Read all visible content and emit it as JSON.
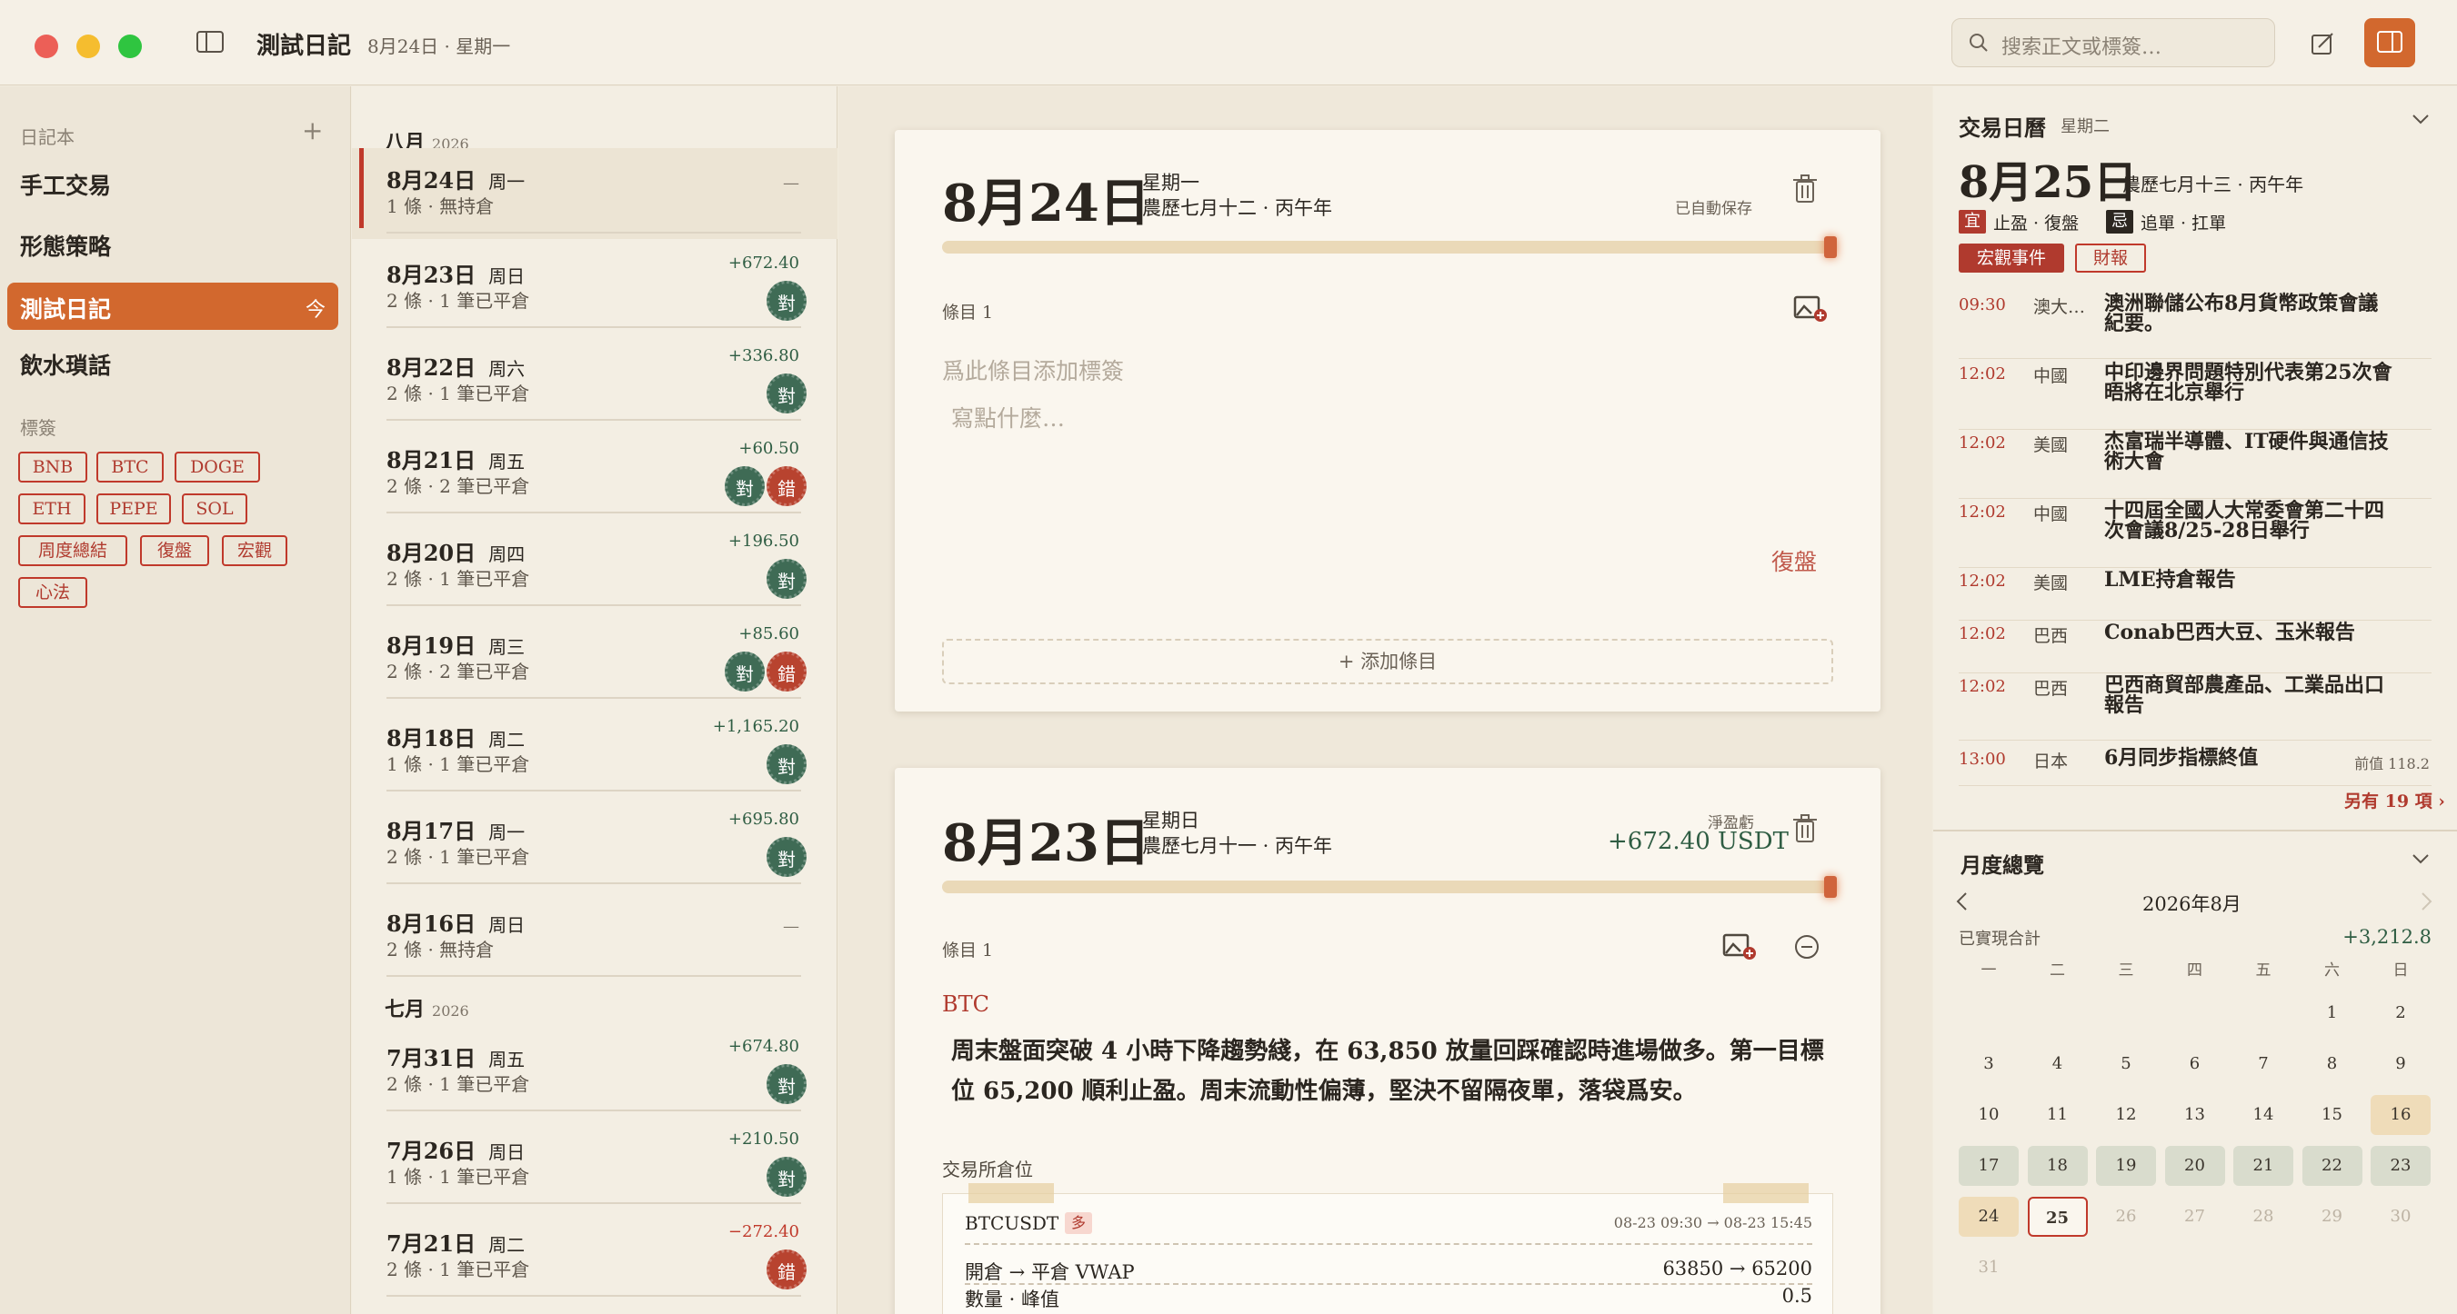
{
  "window": {
    "title": "測試日記",
    "subtitle": "8月24日 · 星期一",
    "search_placeholder": "搜索正文或標簽…"
  },
  "colors": {
    "accent": "#d2682e",
    "red": "#b03a2e",
    "win": "#3f6b55",
    "loss": "#b8432f"
  },
  "sidebar": {
    "notebooks_label": "日記本",
    "add_icon": "+",
    "notebooks": [
      "手工交易",
      "形態策略",
      "測試日記",
      "飲水瑣話"
    ],
    "active_icon": "今",
    "tags_label": "標簽",
    "tags": [
      "BNB",
      "BTC",
      "DOGE",
      "ETH",
      "PEPE",
      "SOL",
      "周度總結",
      "復盤",
      "宏觀",
      "心法"
    ]
  },
  "list": {
    "months": [
      {
        "name": "八月",
        "year": "2026"
      },
      {
        "name": "七月",
        "year": "2026"
      }
    ],
    "entries": [
      {
        "date": "8月24日",
        "weekday": "周一",
        "summary": "1 條 · 無持倉",
        "value": "—"
      },
      {
        "date": "8月23日",
        "weekday": "周日",
        "summary": "2 條 · 1 筆已平倉",
        "value": "+672.40",
        "seals": [
          "對"
        ]
      },
      {
        "date": "8月22日",
        "weekday": "周六",
        "summary": "2 條 · 1 筆已平倉",
        "value": "+336.80",
        "seals": [
          "對"
        ]
      },
      {
        "date": "8月21日",
        "weekday": "周五",
        "summary": "2 條 · 2 筆已平倉",
        "value": "+60.50",
        "seals": [
          "對",
          "錯"
        ]
      },
      {
        "date": "8月20日",
        "weekday": "周四",
        "summary": "2 條 · 1 筆已平倉",
        "value": "+196.50",
        "seals": [
          "對"
        ]
      },
      {
        "date": "8月19日",
        "weekday": "周三",
        "summary": "2 條 · 2 筆已平倉",
        "value": "+85.60",
        "seals": [
          "對",
          "錯"
        ]
      },
      {
        "date": "8月18日",
        "weekday": "周二",
        "summary": "1 條 · 1 筆已平倉",
        "value": "+1,165.20",
        "seals": [
          "對"
        ]
      },
      {
        "date": "8月17日",
        "weekday": "周一",
        "summary": "2 條 · 1 筆已平倉",
        "value": "+695.80",
        "seals": [
          "對"
        ]
      },
      {
        "date": "8月16日",
        "weekday": "周日",
        "summary": "2 條 · 無持倉",
        "value": "—"
      },
      {
        "date": "7月31日",
        "weekday": "周五",
        "summary": "2 條 · 1 筆已平倉",
        "value": "+674.80",
        "seals": [
          "對"
        ]
      },
      {
        "date": "7月26日",
        "weekday": "周日",
        "summary": "1 條 · 1 筆已平倉",
        "value": "+210.50",
        "seals": [
          "對"
        ]
      },
      {
        "date": "7月21日",
        "weekday": "周二",
        "summary": "2 條 · 1 筆已平倉",
        "value": "−272.40",
        "seals": [
          "錯"
        ]
      }
    ]
  },
  "card1": {
    "date": "8月24日",
    "weekday": "星期一",
    "lunar": "農歷七月十二 · 丙午年",
    "saved": "已自動保存",
    "item_label": "條目 1",
    "tag_placeholder": "爲此條目添加標簽",
    "body_placeholder": "寫點什麼…",
    "tag_badge": "復盤",
    "add_item": "添加條目"
  },
  "card2": {
    "date": "8月23日",
    "weekday": "星期日",
    "lunar": "農歷七月十一 · 丙午年",
    "pnl_label": "淨盈虧",
    "pnl": "+672.40 USDT",
    "item_label": "條目 1",
    "tag": "BTC",
    "body": "周末盤面突破 4 小時下降趨勢綫，在 63,850 放量回踩確認時進場做多。第一目標位 65,200 順利止盈。周末流動性偏薄，堅決不留隔夜單，落袋爲安。",
    "position_label": "交易所倉位",
    "ticket": {
      "symbol": "BTCUSDT",
      "side": "多",
      "time": "08-23 09:30 → 08-23 15:45",
      "row1_label": "開倉 → 平倉 VWAP",
      "row1_value": "63850 → 65200",
      "row2_label": "數量 · 峰值",
      "row2_value": "0.5"
    }
  },
  "calendar_panel": {
    "title": "交易日曆",
    "weekday": "星期二",
    "date": "8月25日",
    "lunar": "農歷七月十三 · 丙午年",
    "yi": "宜",
    "yi_text": "止盈 · 復盤",
    "ji": "忌",
    "ji_text": "追單 · 扛單",
    "tabs": [
      "宏觀事件",
      "財報"
    ],
    "events": [
      {
        "time": "09:30",
        "country": "澳大…",
        "title": "澳洲聯儲公布8月貨幣政策會議紀要。"
      },
      {
        "time": "12:02",
        "country": "中國",
        "title": "中印邊界問題特別代表第25次會晤將在北京舉行"
      },
      {
        "time": "12:02",
        "country": "美國",
        "title": "杰富瑞半導體、IT硬件與通信技術大會"
      },
      {
        "time": "12:02",
        "country": "中國",
        "title": "十四屆全國人大常委會第二十四次會議8/25-28日舉行"
      },
      {
        "time": "12:02",
        "country": "美國",
        "title": "LME持倉報告"
      },
      {
        "time": "12:02",
        "country": "巴西",
        "title": "Conab巴西大豆、玉米報告"
      },
      {
        "time": "12:02",
        "country": "巴西",
        "title": "巴西商貿部農產品、工業品出口報告"
      },
      {
        "time": "13:00",
        "country": "日本",
        "title": "6月同步指標終值",
        "extra": "前值 118.2"
      }
    ],
    "more": "另有 19 項 ›"
  },
  "monthly": {
    "title": "月度總覽",
    "month": "2026年8月",
    "realized_label": "已實現合計",
    "realized": "+3,212.8",
    "weekdays": [
      "一",
      "二",
      "三",
      "四",
      "五",
      "六",
      "日"
    ],
    "days": [
      {
        "d": "1",
        "c": 5,
        "r": 0
      },
      {
        "d": "2",
        "c": 6,
        "r": 0
      },
      {
        "d": "3",
        "c": 0,
        "r": 1
      },
      {
        "d": "4",
        "c": 1,
        "r": 1
      },
      {
        "d": "5",
        "c": 2,
        "r": 1
      },
      {
        "d": "6",
        "c": 3,
        "r": 1
      },
      {
        "d": "7",
        "c": 4,
        "r": 1
      },
      {
        "d": "8",
        "c": 5,
        "r": 1
      },
      {
        "d": "9",
        "c": 6,
        "r": 1
      },
      {
        "d": "10",
        "c": 0,
        "r": 2
      },
      {
        "d": "11",
        "c": 1,
        "r": 2
      },
      {
        "d": "12",
        "c": 2,
        "r": 2
      },
      {
        "d": "13",
        "c": 3,
        "r": 2
      },
      {
        "d": "14",
        "c": 4,
        "r": 2
      },
      {
        "d": "15",
        "c": 5,
        "r": 2
      },
      {
        "d": "16",
        "c": 6,
        "r": 2,
        "k": "t"
      },
      {
        "d": "17",
        "c": 0,
        "r": 3,
        "k": "g"
      },
      {
        "d": "18",
        "c": 1,
        "r": 3,
        "k": "g"
      },
      {
        "d": "19",
        "c": 2,
        "r": 3,
        "k": "g"
      },
      {
        "d": "20",
        "c": 3,
        "r": 3,
        "k": "g"
      },
      {
        "d": "21",
        "c": 4,
        "r": 3,
        "k": "g"
      },
      {
        "d": "22",
        "c": 5,
        "r": 3,
        "k": "g"
      },
      {
        "d": "23",
        "c": 6,
        "r": 3,
        "k": "g"
      },
      {
        "d": "24",
        "c": 0,
        "r": 4,
        "k": "t"
      },
      {
        "d": "25",
        "c": 1,
        "r": 4,
        "k": "sel"
      },
      {
        "d": "26",
        "c": 2,
        "r": 4,
        "k": "f"
      },
      {
        "d": "27",
        "c": 3,
        "r": 4,
        "k": "f"
      },
      {
        "d": "28",
        "c": 4,
        "r": 4,
        "k": "f"
      },
      {
        "d": "29",
        "c": 5,
        "r": 4,
        "k": "f"
      },
      {
        "d": "30",
        "c": 6,
        "r": 4,
        "k": "f"
      },
      {
        "d": "31",
        "c": 0,
        "r": 5,
        "k": "f"
      }
    ]
  }
}
